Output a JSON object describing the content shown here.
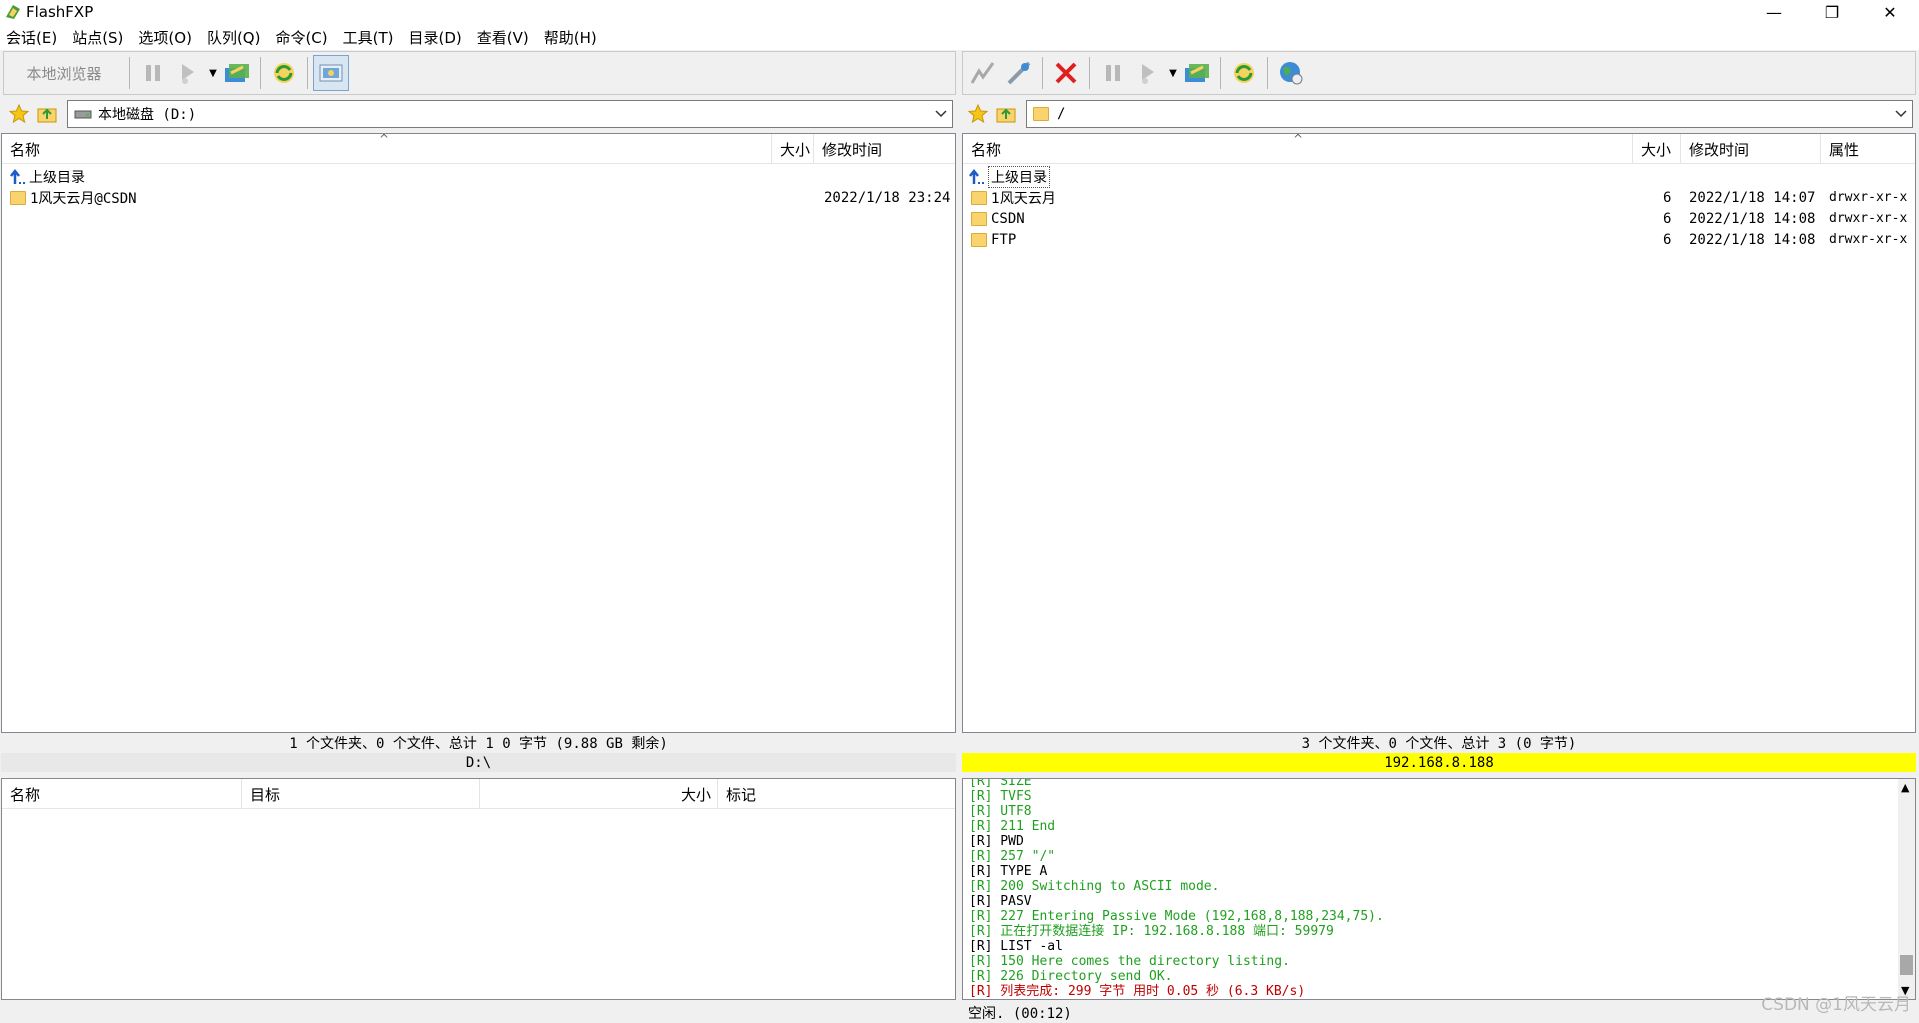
{
  "window": {
    "title": "FlashFXP",
    "minimize": "—",
    "maximize": "❐",
    "close": "✕"
  },
  "menu": [
    "会话(E)",
    "站点(S)",
    "选项(O)",
    "队列(Q)",
    "命令(C)",
    "工具(T)",
    "目录(D)",
    "查看(V)",
    "帮助(H)"
  ],
  "left_toolbar": {
    "browser_label": "本地浏览器"
  },
  "left_path": {
    "value": "本地磁盘 (D:)"
  },
  "right_path": {
    "value": "/"
  },
  "left_list": {
    "columns": [
      "名称",
      "大小",
      "修改时间"
    ],
    "rows": [
      {
        "name": "上级目录",
        "type": "up",
        "size": "",
        "modified": ""
      },
      {
        "name": "1风天云月@CSDN",
        "type": "folder",
        "size": "",
        "modified": "2022/1/18 23:24"
      }
    ],
    "status": "1 个文件夹、0 个文件、总计 1 0 字节 (9.88 GB 剩余)",
    "path_status": "D:\\"
  },
  "right_list": {
    "columns": [
      "名称",
      "大小",
      "修改时间",
      "属性"
    ],
    "rows": [
      {
        "name": "上级目录",
        "type": "up",
        "size": "",
        "modified": "",
        "attr": ""
      },
      {
        "name": "1风天云月",
        "type": "folder",
        "size": "6",
        "modified": "2022/1/18 14:07",
        "attr": "drwxr-xr-x"
      },
      {
        "name": "CSDN",
        "type": "folder",
        "size": "6",
        "modified": "2022/1/18 14:08",
        "attr": "drwxr-xr-x"
      },
      {
        "name": "FTP",
        "type": "folder",
        "size": "6",
        "modified": "2022/1/18 14:08",
        "attr": "drwxr-xr-x"
      }
    ],
    "status": "3 个文件夹、0 个文件、总计 3 (0 字节)",
    "host_status": "192.168.8.188",
    "host_color": "#ffff00"
  },
  "queue": {
    "columns": [
      "名称",
      "目标",
      "大小",
      "标记"
    ]
  },
  "log": {
    "lines": [
      {
        "tag": "[R]",
        "text": "  SIZE",
        "color": "g"
      },
      {
        "tag": "[R]",
        "text": "  TVFS",
        "color": "g"
      },
      {
        "tag": "[R]",
        "text": "  UTF8",
        "color": "g"
      },
      {
        "tag": "[R]",
        "text": " 211 End",
        "color": "g"
      },
      {
        "tag": "[R]",
        "text": " PWD",
        "color": "r"
      },
      {
        "tag": "[R]",
        "text": " 257 \"/\"",
        "color": "g"
      },
      {
        "tag": "[R]",
        "text": " TYPE A",
        "color": "r"
      },
      {
        "tag": "[R]",
        "text": " 200 Switching to ASCII mode.",
        "color": "g"
      },
      {
        "tag": "[R]",
        "text": " PASV",
        "color": "r"
      },
      {
        "tag": "[R]",
        "text": " 227 Entering Passive Mode (192,168,8,188,234,75).",
        "color": "g"
      },
      {
        "tag": "[R]",
        "text": " 正在打开数据连接 IP: 192.168.8.188 端口: 59979",
        "color": "g"
      },
      {
        "tag": "[R]",
        "text": " LIST -al",
        "color": "r"
      },
      {
        "tag": "[R]",
        "text": " 150 Here comes the directory listing.",
        "color": "g"
      },
      {
        "tag": "[R]",
        "text": " 226 Directory send OK.",
        "color": "g"
      },
      {
        "tag": "[R]",
        "text": " 列表完成: 299 字节 用时 0.05 秒 (6.3 KB/s)",
        "color": "red"
      }
    ],
    "status": "空闲. (00:12)"
  },
  "watermark": "CSDN @1风天云月",
  "colors": {
    "log_green": "#20a020",
    "log_red": "#c00000"
  }
}
